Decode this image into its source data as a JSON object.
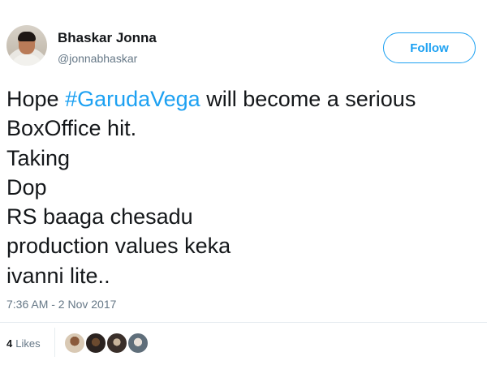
{
  "user": {
    "display_name": "Bhaskar Jonna",
    "handle": "@jonnabhaskar",
    "avatar_icon": "user-avatar"
  },
  "follow_button": {
    "label": "Follow"
  },
  "tweet": {
    "line1_prefix": "Hope ",
    "line1_hashtag": "#GarudaVega",
    "line1_suffix": " will become a serious",
    "lines": [
      "BoxOffice hit.",
      "Taking",
      "Dop",
      "RS baaga chesadu",
      "production values keka",
      "ivanni lite.."
    ],
    "timestamp": "7:36 AM - 2 Nov 2017"
  },
  "likes": {
    "count": "4",
    "label": "Likes"
  },
  "colors": {
    "accent": "#1da1f2",
    "text": "#14171a",
    "secondary_text": "#657786",
    "divider": "#e6ecf0"
  }
}
